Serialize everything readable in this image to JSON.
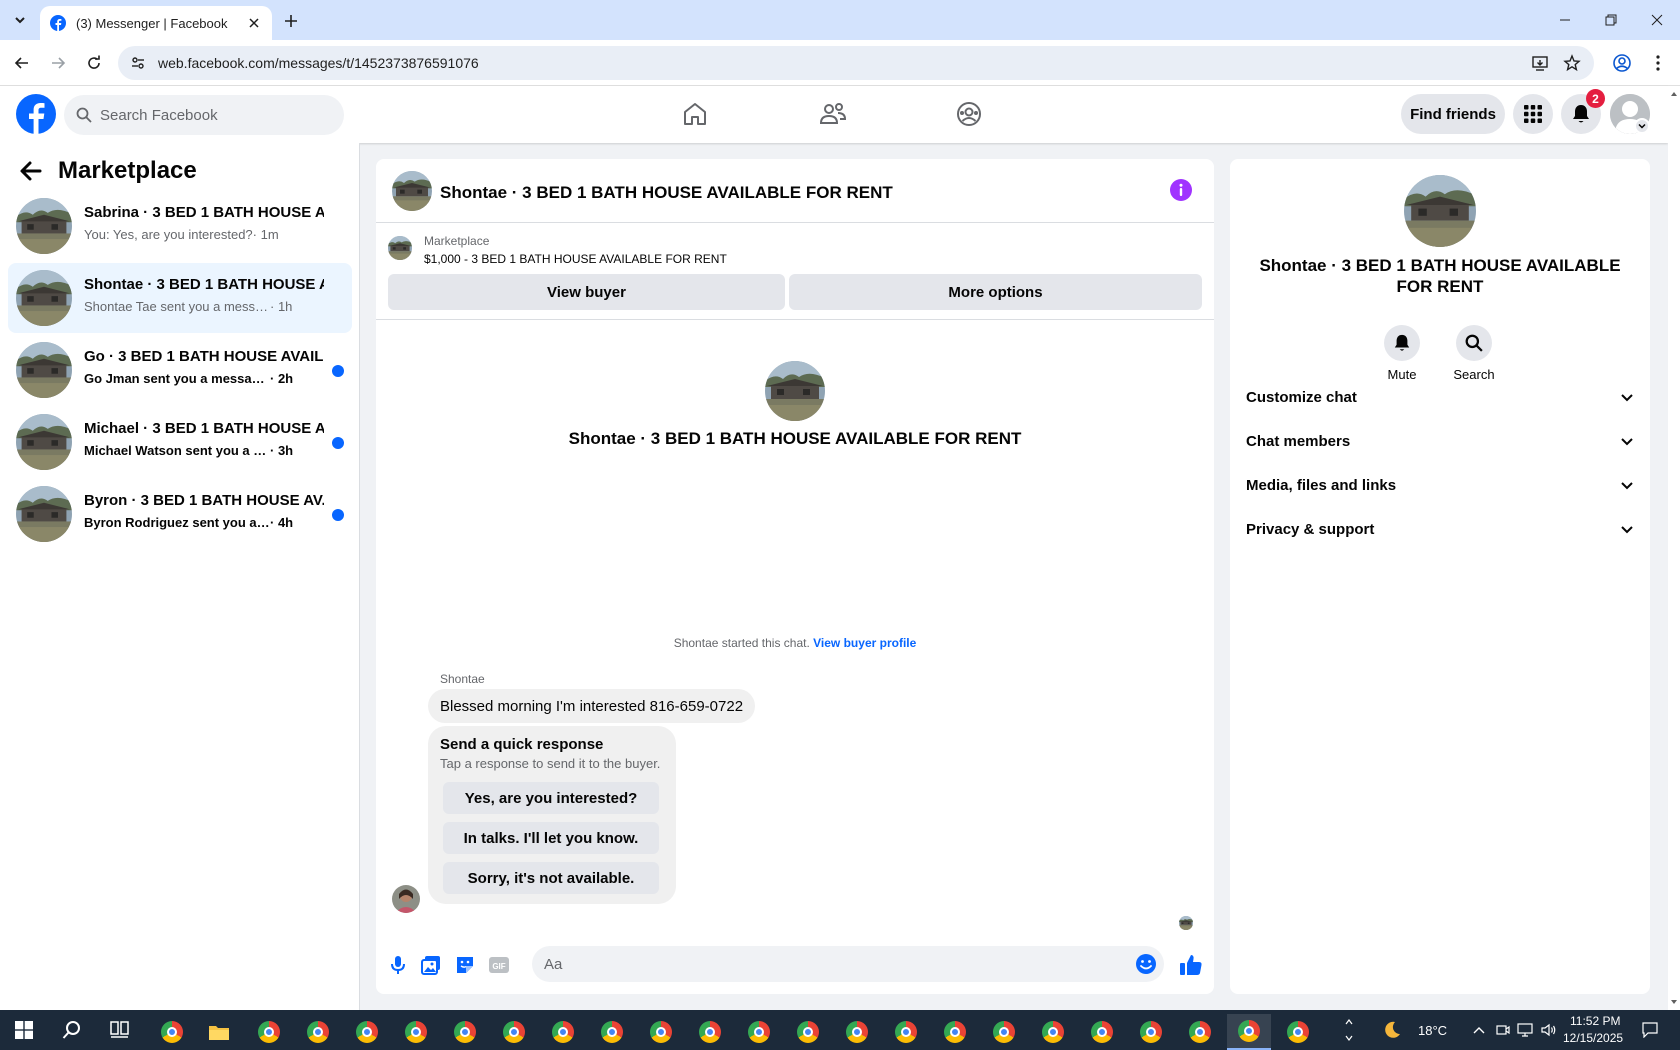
{
  "browser": {
    "tab_title": "(3) Messenger | Facebook",
    "url": "web.facebook.com/messages/t/1452373876591076"
  },
  "header": {
    "search_placeholder": "Search Facebook",
    "find_friends": "Find friends",
    "notification_count": "2"
  },
  "sidebar": {
    "title": "Marketplace",
    "conversations": [
      {
        "name": "Sabrina · 3 BED 1 BATH HOUSE AV...",
        "snippet": "You: Yes, are you interested?",
        "time": " · 1m",
        "active": false,
        "unread": false
      },
      {
        "name": "Shontae · 3 BED 1 BATH HOUSE AV...",
        "snippet": "Shontae Tae sent you a message abou...",
        "time": " · 1h",
        "active": true,
        "unread": false
      },
      {
        "name": "Go · 3 BED 1 BATH HOUSE AVAIL...",
        "snippet": "Go Jman sent you a message abou...",
        "time": " · 2h",
        "active": false,
        "unread": true
      },
      {
        "name": "Michael · 3 BED 1 BATH HOUSE A...",
        "snippet": "Michael Watson sent you a messa...",
        "time": " · 3h",
        "active": false,
        "unread": true
      },
      {
        "name": "Byron · 3 BED 1 BATH HOUSE AV...",
        "snippet": "Byron Rodriguez sent you a messa...",
        "time": " · 4h",
        "active": false,
        "unread": true
      }
    ]
  },
  "chat": {
    "title": "Shontae · 3 BED 1 BATH HOUSE AVAILABLE FOR RENT",
    "marketplace_label": "Marketplace",
    "listing": "$1,000 - 3 BED 1 BATH HOUSE AVAILABLE FOR RENT",
    "view_buyer": "View buyer",
    "more_options": "More options",
    "intro_name": "Shontae · 3 BED 1 BATH HOUSE AVAILABLE FOR RENT",
    "started_text": "Shontae started this chat.",
    "view_buyer_profile": "View buyer profile",
    "sender_name": "Shontae",
    "message": "Blessed morning I'm interested 816-659-0722",
    "quick_title": "Send a quick response",
    "quick_subtitle": "Tap a response to send it to the buyer.",
    "quick_responses": [
      "Yes, are you interested?",
      "In talks. I'll let you know.",
      "Sorry, it's not available."
    ],
    "composer_placeholder": "Aa"
  },
  "info_panel": {
    "name": "Shontae · 3 BED 1 BATH HOUSE AVAILABLE FOR RENT",
    "mute": "Mute",
    "search": "Search",
    "sections": [
      "Customize chat",
      "Chat members",
      "Media, files and links",
      "Privacy & support"
    ]
  },
  "taskbar": {
    "temperature": "18°C",
    "time": "11:52 PM",
    "date": "12/15/2025"
  },
  "colors": {
    "fb_blue": "#0866ff",
    "active_conv_bg": "#ebf5ff",
    "unread_dot": "#0866ff",
    "info_icon": "#a033ff",
    "badge_red": "#e41e3f"
  }
}
